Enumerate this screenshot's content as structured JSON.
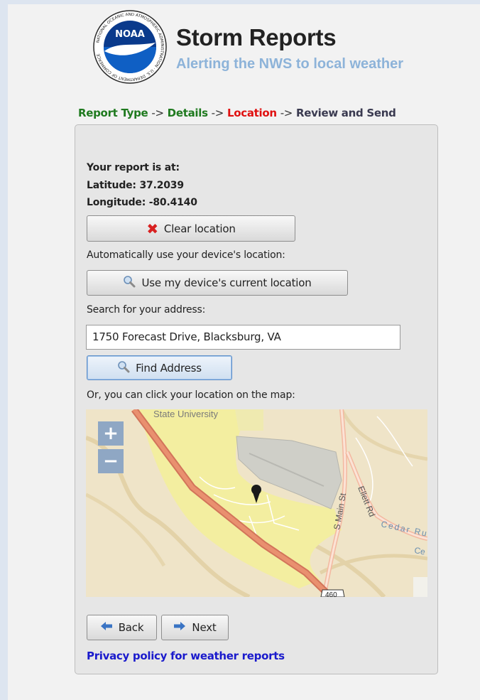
{
  "header": {
    "title": "Storm Reports",
    "subtitle": "Alerting the NWS to local weather",
    "logo_text": "NOAA",
    "logo_ring_text": "NATIONAL OCEANIC AND ATMOSPHERIC ADMINISTRATION · U.S. DEPARTMENT OF COMMERCE"
  },
  "breadcrumb": {
    "step1": "Report Type",
    "step2": "Details",
    "step3": "Location",
    "step4": "Review and Send",
    "separator": "->"
  },
  "location": {
    "heading": "Your report is at:",
    "latitude": "Latitude: 37.2039",
    "longitude": "Longitude: -80.4140"
  },
  "buttons": {
    "clear_location": "Clear location",
    "use_device_location": "Use my device's current location",
    "find_address": "Find Address",
    "back": "Back",
    "next": "Next"
  },
  "labels": {
    "auto_location": "Automatically use your device's location:",
    "search_address": "Search for your address:",
    "click_map": "Or, you can click your location on the map:"
  },
  "search": {
    "value": "1750 Forecast Drive, Blacksburg, VA"
  },
  "map": {
    "labels": {
      "university": "State University",
      "main_st": "S Main St",
      "ellett_rd": "Ellett Rd",
      "cedar_run": "Cedar Ru",
      "cedar_run2": "Ce",
      "route": "460"
    },
    "zoom_in": "+",
    "zoom_out": "−"
  },
  "footer": {
    "privacy_link": "Privacy policy for weather reports"
  },
  "colors": {
    "step_done": "#1f7a1f",
    "step_current": "#e01010",
    "link": "#1a1acc",
    "subtitle": "#8db3d9"
  }
}
